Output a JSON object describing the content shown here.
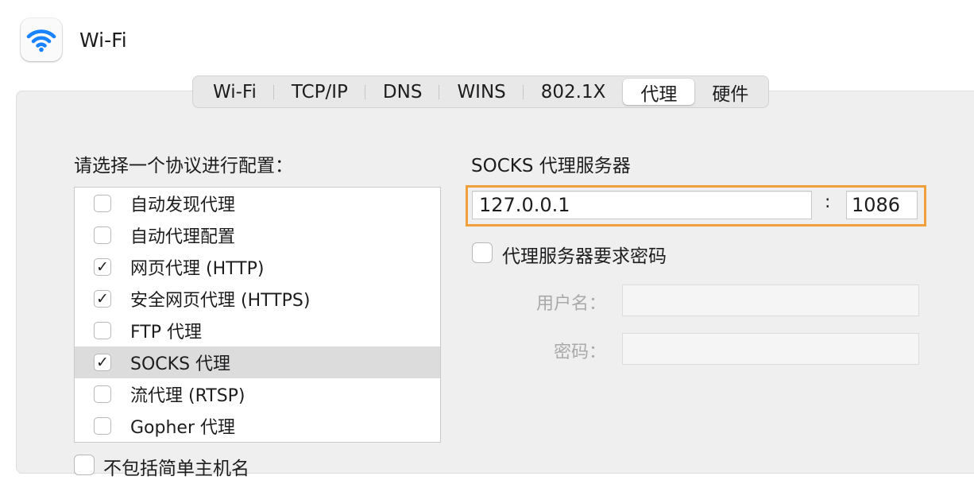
{
  "header": {
    "title": "Wi-Fi",
    "icon": "wifi-icon",
    "accent": "#1a82fb"
  },
  "tabs": [
    {
      "label": "Wi-Fi",
      "active": false
    },
    {
      "label": "TCP/IP",
      "active": false
    },
    {
      "label": "DNS",
      "active": false
    },
    {
      "label": "WINS",
      "active": false
    },
    {
      "label": "802.1X",
      "active": false
    },
    {
      "label": "代理",
      "active": true
    },
    {
      "label": "硬件",
      "active": false
    }
  ],
  "protocols": {
    "heading": "请选择一个协议进行配置：",
    "items": [
      {
        "label": "自动发现代理",
        "checked": false,
        "selected": false
      },
      {
        "label": "自动代理配置",
        "checked": false,
        "selected": false
      },
      {
        "label": "网页代理 (HTTP)",
        "checked": true,
        "selected": false
      },
      {
        "label": "安全网页代理 (HTTPS)",
        "checked": true,
        "selected": false
      },
      {
        "label": "FTP 代理",
        "checked": false,
        "selected": false
      },
      {
        "label": "SOCKS 代理",
        "checked": true,
        "selected": true
      },
      {
        "label": "流代理 (RTSP)",
        "checked": false,
        "selected": false
      },
      {
        "label": "Gopher 代理",
        "checked": false,
        "selected": false
      }
    ],
    "bottom_option": "不包括简单主机名"
  },
  "socks": {
    "heading": "SOCKS 代理服务器",
    "server": "127.0.0.1",
    "colon": ":",
    "port": "1086",
    "highlight_color": "#f0a03a",
    "password_required_label": "代理服务器要求密码",
    "password_required": false,
    "username_label": "用户名：",
    "username": "",
    "password_label": "密码：",
    "password": ""
  }
}
